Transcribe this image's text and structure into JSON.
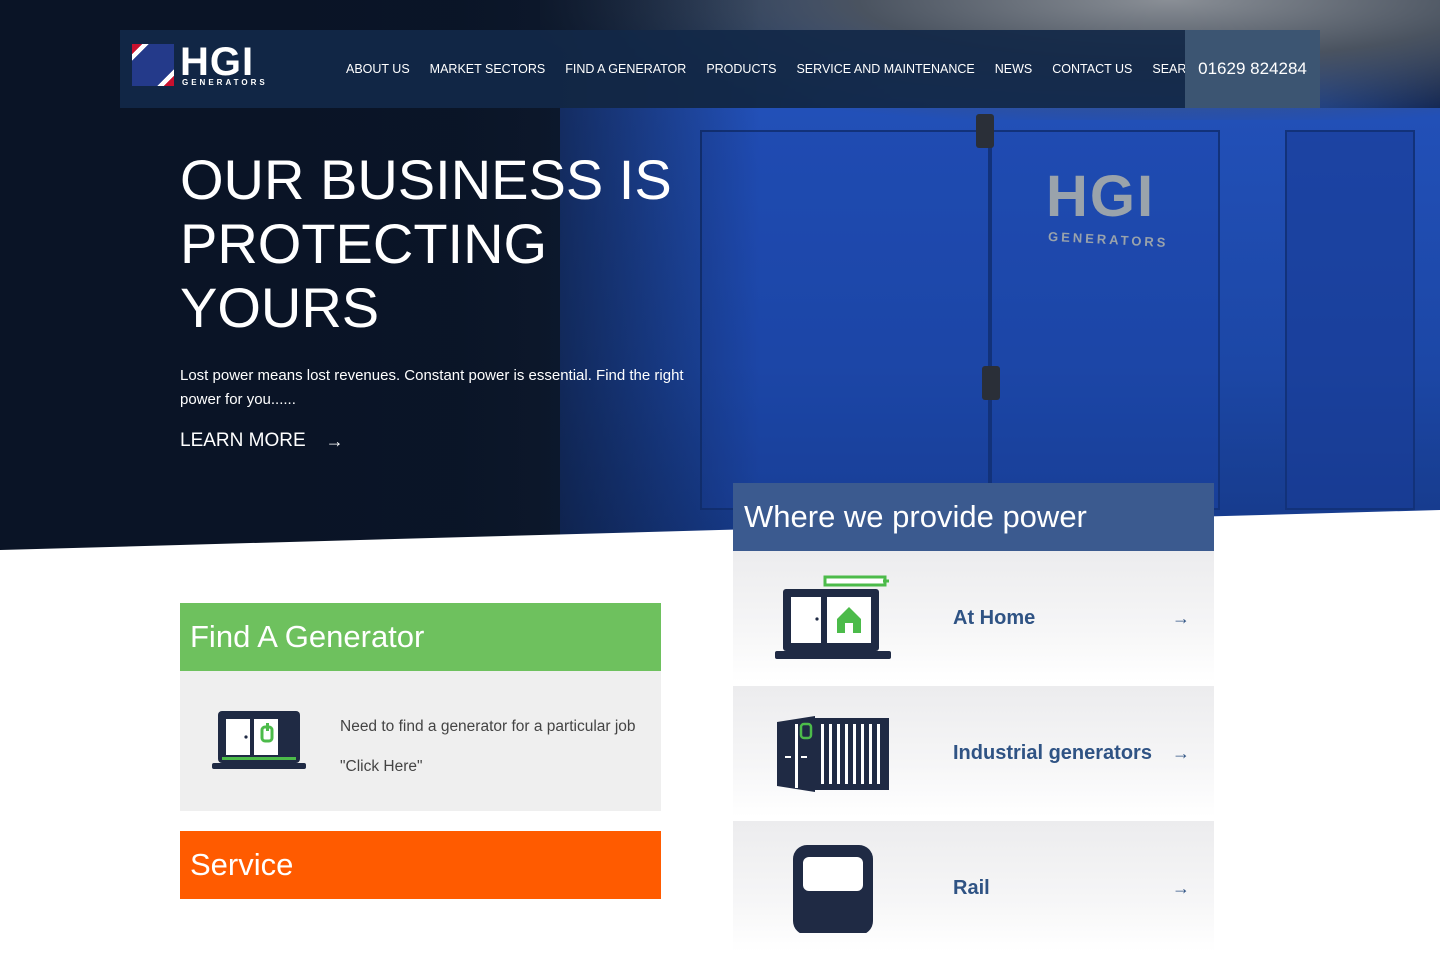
{
  "header": {
    "logo_text": "HGI",
    "logo_sub": "GENERATORS",
    "nav": [
      "ABOUT US",
      "MARKET SECTORS",
      "FIND A GENERATOR",
      "PRODUCTS",
      "SERVICE AND MAINTENANCE",
      "NEWS",
      "CONTACT US",
      "SEARCH"
    ],
    "phone": "01629 824284"
  },
  "hero": {
    "headline": "OUR BUSINESS IS PROTECTING YOURS",
    "lede": "Lost power means lost revenues. Constant power is essential. Find the right power for you......",
    "cta": "LEARN MORE",
    "generator_logo": "HGI",
    "generator_logo_sub": "GENERATORS"
  },
  "find_generator": {
    "title": "Find A Generator",
    "line1": "Need to find a generator for a particular job",
    "line2": "\"Click Here\""
  },
  "service": {
    "title": "Service"
  },
  "power": {
    "title": "Where we provide power",
    "items": [
      {
        "label": "At Home",
        "icon": "home-generator-icon"
      },
      {
        "label": "Industrial generators",
        "icon": "container-generator-icon"
      },
      {
        "label": "Rail",
        "icon": "train-icon"
      }
    ]
  },
  "colors": {
    "green": "#6ec15e",
    "orange": "#ff5b00",
    "blue_header": "#3b5a8f",
    "link_blue": "#2f5384"
  }
}
